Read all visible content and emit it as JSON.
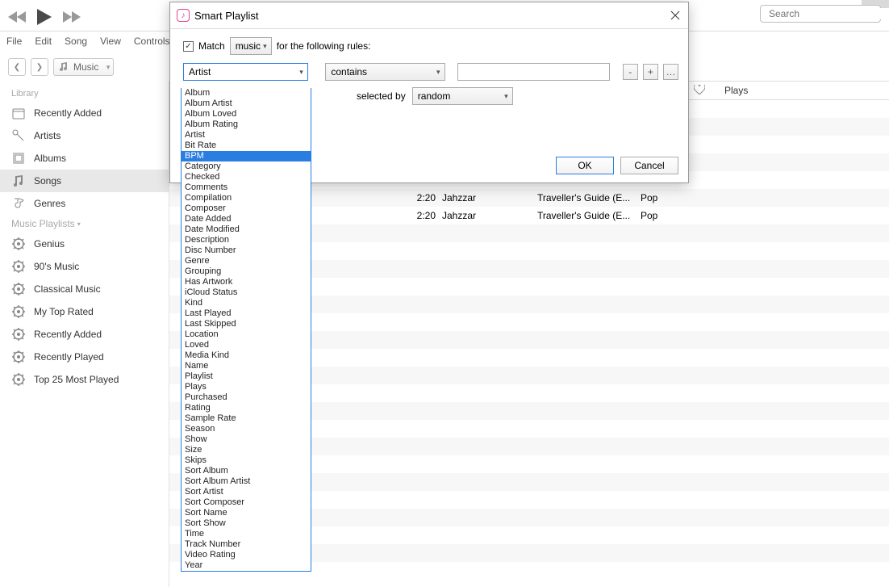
{
  "window_controls": {
    "minimize": "−",
    "maximize": "□",
    "close": "×"
  },
  "search": {
    "placeholder": "Search"
  },
  "menubar": [
    "File",
    "Edit",
    "Song",
    "View",
    "Controls"
  ],
  "media_picker": {
    "label": "Music"
  },
  "col_headers": {
    "plays": "Plays"
  },
  "sidebar": {
    "section_library": "Library",
    "library": [
      {
        "label": "Recently Added"
      },
      {
        "label": "Artists"
      },
      {
        "label": "Albums"
      },
      {
        "label": "Songs"
      },
      {
        "label": "Genres"
      }
    ],
    "section_playlists": "Music Playlists",
    "playlists": [
      {
        "label": "Genius"
      },
      {
        "label": "90's Music"
      },
      {
        "label": "Classical Music"
      },
      {
        "label": "My Top Rated"
      },
      {
        "label": "Recently Added"
      },
      {
        "label": "Recently Played"
      },
      {
        "label": "Top 25 Most Played"
      }
    ]
  },
  "tracks": [
    {
      "time": "2:20",
      "artist": "Jahzzar",
      "album": "Traveller's Guide (E...",
      "genre": "Pop"
    },
    {
      "time": "2:20",
      "artist": "Jahzzar",
      "album": "Traveller's Guide (E...",
      "genre": "Pop"
    }
  ],
  "dialog": {
    "title": "Smart Playlist",
    "match_label": "Match",
    "match_type": "music",
    "rules_suffix": "for the following rules:",
    "field_select": "Artist",
    "operator": "contains",
    "value": "",
    "minus": "-",
    "plus": "+",
    "ellipsis": "…",
    "selected_by_label": "selected by",
    "selected_by_value": "random",
    "ok": "OK",
    "cancel": "Cancel"
  },
  "field_options": [
    "Album",
    "Album Artist",
    "Album Loved",
    "Album Rating",
    "Artist",
    "Bit Rate",
    "BPM",
    "Category",
    "Checked",
    "Comments",
    "Compilation",
    "Composer",
    "Date Added",
    "Date Modified",
    "Description",
    "Disc Number",
    "Genre",
    "Grouping",
    "Has Artwork",
    "iCloud Status",
    "Kind",
    "Last Played",
    "Last Skipped",
    "Location",
    "Loved",
    "Media Kind",
    "Name",
    "Playlist",
    "Plays",
    "Purchased",
    "Rating",
    "Sample Rate",
    "Season",
    "Show",
    "Size",
    "Skips",
    "Sort Album",
    "Sort Album Artist",
    "Sort Artist",
    "Sort Composer",
    "Sort Name",
    "Sort Show",
    "Time",
    "Track Number",
    "Video Rating",
    "Year"
  ],
  "highlighted_option": "BPM"
}
